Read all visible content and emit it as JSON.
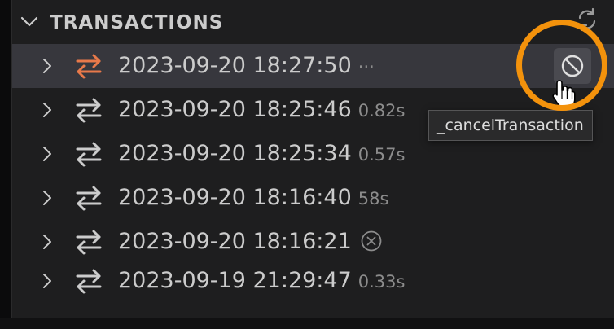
{
  "section": {
    "title": "TRANSACTIONS",
    "expanded": true
  },
  "transactions": [
    {
      "label": "2023-09-20 18:27:50",
      "description": "···",
      "status": "running",
      "selected": true
    },
    {
      "label": "2023-09-20 18:25:46",
      "description": "0.82s",
      "status": "done",
      "selected": false
    },
    {
      "label": "2023-09-20 18:25:34",
      "description": "0.57s",
      "status": "done",
      "selected": false
    },
    {
      "label": "2023-09-20 18:16:40",
      "description": "58s",
      "status": "done",
      "selected": false
    },
    {
      "label": "2023-09-20 18:16:21",
      "description": "",
      "status": "cancelled",
      "status_icon": "circle-x-icon",
      "selected": false
    },
    {
      "label": "2023-09-19 21:29:47",
      "description": "0.33s",
      "status": "done",
      "selected": false
    }
  ],
  "actions": {
    "cancel": {
      "icon": "cancel-circle-slash-icon",
      "tooltip": "_cancelTransaction"
    },
    "refresh": {
      "icon": "refresh-icon"
    }
  },
  "colors": {
    "panel_bg": "#1e1e1f",
    "selected_row_bg": "#37373d",
    "text": "#cccccc",
    "description_text": "#8c8c8c",
    "active_icon": "#e8794a",
    "icon": "#cccccc",
    "highlight_ring": "#f3920c"
  }
}
